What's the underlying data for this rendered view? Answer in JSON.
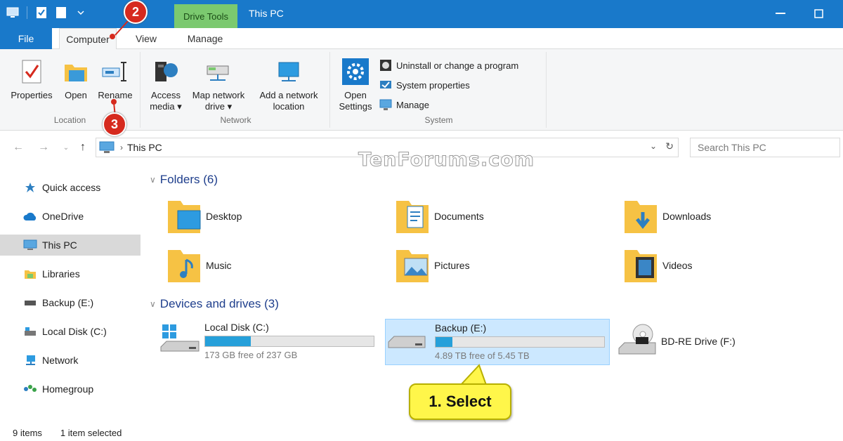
{
  "titlebar": {
    "context_tab": "Drive Tools",
    "title": "This PC"
  },
  "tabs": {
    "file": "File",
    "computer": "Computer",
    "view": "View",
    "manage": "Manage"
  },
  "ribbon": {
    "location": {
      "label": "Location",
      "properties": "Properties",
      "open": "Open",
      "rename": "Rename"
    },
    "network": {
      "label": "Network",
      "access_media_1": "Access",
      "access_media_2": "media ▾",
      "map_drive_1": "Map network",
      "map_drive_2": "drive ▾",
      "add_location_1": "Add a network",
      "add_location_2": "location"
    },
    "system": {
      "label": "System",
      "open_settings_1": "Open",
      "open_settings_2": "Settings",
      "uninstall": "Uninstall or change a program",
      "system_properties": "System properties",
      "manage": "Manage"
    }
  },
  "address": {
    "crumb": "This PC",
    "search_placeholder": "Search This PC"
  },
  "watermark": "TenForums.com",
  "nav": {
    "items": [
      {
        "label": "Quick access"
      },
      {
        "label": "OneDrive"
      },
      {
        "label": "This PC"
      },
      {
        "label": "Libraries"
      },
      {
        "label": "Backup (E:)"
      },
      {
        "label": "Local Disk (C:)"
      },
      {
        "label": "Network"
      },
      {
        "label": "Homegroup"
      }
    ]
  },
  "content": {
    "folders_header": "Folders (6)",
    "folders": [
      "Desktop",
      "Documents",
      "Downloads",
      "Music",
      "Pictures",
      "Videos"
    ],
    "devices_header": "Devices and drives (3)",
    "drives": [
      {
        "name": "Local Disk (C:)",
        "free": "173 GB free of 237 GB",
        "used_fraction": 0.27
      },
      {
        "name": "Backup (E:)",
        "free": "4.89 TB free of 5.45 TB",
        "used_fraction": 0.1
      },
      {
        "name": "BD-RE Drive (F:)"
      }
    ]
  },
  "status": {
    "items": "9 items",
    "selected": "1 item selected"
  },
  "callouts": {
    "step1": "1. Select",
    "step2": "2",
    "step3": "3"
  },
  "colors": {
    "accent": "#1979ca",
    "context_tab": "#7bc96f",
    "selection": "#cce8ff",
    "callout": "#fff64a",
    "badge": "#d62a1e"
  }
}
